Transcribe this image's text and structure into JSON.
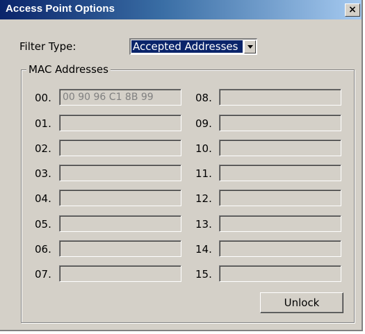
{
  "window": {
    "title": "Access Point Options",
    "close_glyph": "×"
  },
  "filter": {
    "label": "Filter Type:",
    "selected": "Accepted Addresses"
  },
  "mac_group": {
    "legend": "MAC Addresses",
    "entries": [
      {
        "label": "00.",
        "value": "00 90 96 C1 8B 99"
      },
      {
        "label": "01.",
        "value": ""
      },
      {
        "label": "02.",
        "value": ""
      },
      {
        "label": "03.",
        "value": ""
      },
      {
        "label": "04.",
        "value": ""
      },
      {
        "label": "05.",
        "value": ""
      },
      {
        "label": "06.",
        "value": ""
      },
      {
        "label": "07.",
        "value": ""
      },
      {
        "label": "08.",
        "value": ""
      },
      {
        "label": "09.",
        "value": ""
      },
      {
        "label": "10.",
        "value": ""
      },
      {
        "label": "11.",
        "value": ""
      },
      {
        "label": "12.",
        "value": ""
      },
      {
        "label": "13.",
        "value": ""
      },
      {
        "label": "14.",
        "value": ""
      },
      {
        "label": "15.",
        "value": ""
      }
    ]
  },
  "buttons": {
    "unlock_label": "Unlock"
  }
}
